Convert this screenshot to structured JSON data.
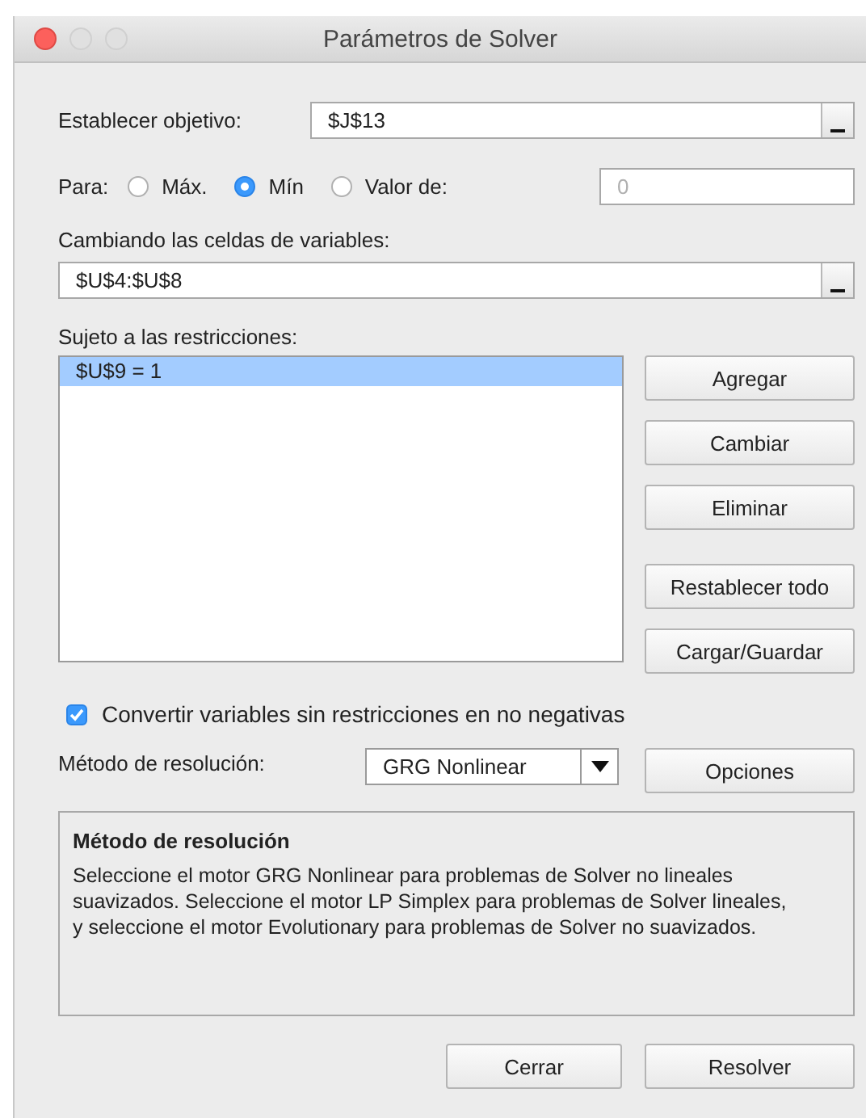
{
  "window": {
    "title": "Parámetros de Solver"
  },
  "objective": {
    "label": "Establecer objetivo:",
    "value": "$J$13"
  },
  "target": {
    "label": "Para:",
    "options": [
      {
        "label": "Máx.",
        "selected": false
      },
      {
        "label": "Mín",
        "selected": true
      },
      {
        "label": "Valor de:",
        "selected": false
      }
    ],
    "value_field": {
      "placeholder": "0"
    }
  },
  "variables": {
    "label": "Cambiando las celdas de variables:",
    "value": "$U$4:$U$8"
  },
  "constraints": {
    "label": "Sujeto a las restricciones:",
    "items": [
      {
        "text": "$U$9 = 1",
        "selected": true
      }
    ],
    "buttons": [
      "Agregar",
      "Cambiar",
      "Eliminar",
      "Restablecer todo",
      "Cargar/Guardar"
    ]
  },
  "nonnegative": {
    "label": "Convertir variables sin restricciones en no negativas",
    "checked": true
  },
  "method": {
    "label": "Método de resolución:",
    "value": "GRG Nonlinear",
    "options_button": "Opciones"
  },
  "info": {
    "title": "Método de resolución",
    "text": "Seleccione el motor GRG Nonlinear para problemas de Solver no lineales suavizados. Seleccione el motor LP Simplex para problemas de Solver lineales, y seleccione el motor Evolutionary para problemas de Solver no suavizados."
  },
  "buttons": [
    "Cerrar",
    "Resolver"
  ]
}
